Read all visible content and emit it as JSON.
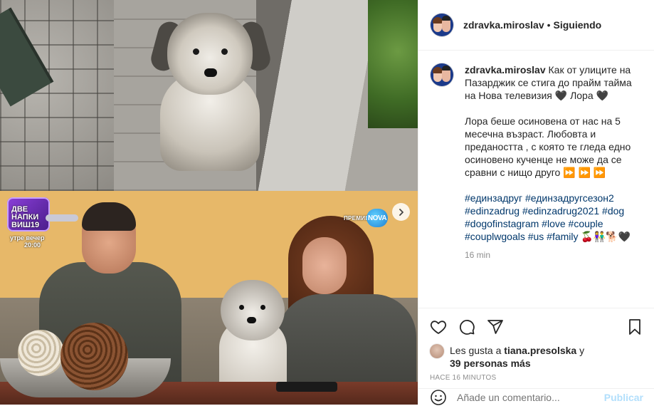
{
  "post": {
    "username": "zdravka.miroslav",
    "follow_status": "Siguiendo",
    "dot": "•",
    "caption_text": "Как от улиците на Пазарджик се стига до прайм тайма на Нова телевизия 🖤 Лора 🖤\n\nЛора беше осиновена от нас на 5 месечна възраст. Любовта и предаността , с която те гледа едно осиновено кученце не може да се сравни с нищо друго ⏩ ⏩ ⏩\n\n",
    "hashtags": "#единзадруг #единзадругсезон2 #edinzadrug #edinzadrug2021 #dog #dogofinstagram #love #couple #couplwgoals #us #family 🍒👫🐕🖤",
    "time_ago": "16 min"
  },
  "media": {
    "promo_title": "ДВЕ\nНАПКИ\nВИШ19",
    "promo_line1": "утре вечер",
    "promo_line2": "20:00",
    "premiera": "ПРЕМИЕРА",
    "nova_logo": "NOVA"
  },
  "likes": {
    "prefix": "Les gusta a ",
    "liker": "tiana.presolska",
    "and": " y",
    "others": "39 personas más",
    "posted": "HACE 16 MINUTOS"
  },
  "comment": {
    "placeholder": "Añade un comentario...",
    "post_label": "Publicar"
  },
  "icons": {
    "like": "heart-icon",
    "comment": "comment-icon",
    "share": "share-icon",
    "save": "bookmark-icon",
    "next": "chevron-right-icon",
    "emoji": "smiley-icon"
  },
  "colors": {
    "hashtag": "#00376b",
    "muted": "#8e8e8e",
    "border": "#efefef",
    "post_button": "#b2dffc"
  }
}
